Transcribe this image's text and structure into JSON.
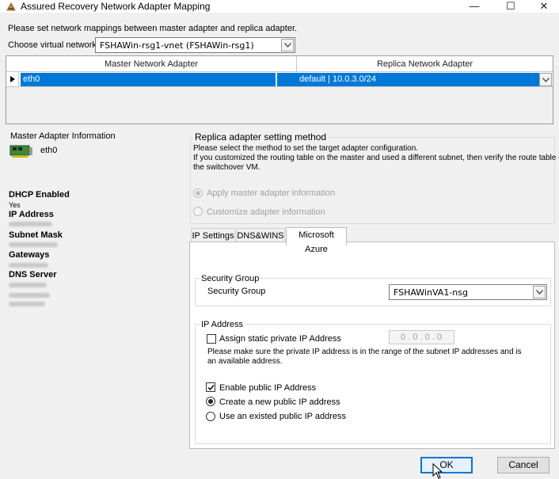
{
  "window": {
    "title": "Assured Recovery Network Adapter Mapping",
    "minimize": "—",
    "maximize": "☐",
    "close": "✕"
  },
  "instructions": "Please set network mappings between master adapter and replica adapter.",
  "virtual_network": {
    "label": "Choose virtual network",
    "value": "FSHAWin-rsg1-vnet (FSHAWin-rsg1)"
  },
  "mapping_grid": {
    "columns": [
      "Master Network Adapter",
      "Replica Network Adapter"
    ],
    "rows": [
      {
        "master": "eth0",
        "replica": "default | 10.0.3.0/24"
      }
    ]
  },
  "master_info": {
    "title": "Master Adapter Information",
    "adapter_name": "eth0",
    "dhcp_label": "DHCP Enabled",
    "dhcp_value": "Yes",
    "ip_label": "IP Address",
    "subnet_label": "Subnet Mask",
    "gateways_label": "Gateways",
    "dns_label": "DNS Server"
  },
  "replica_method": {
    "title": "Replica adapter setting method",
    "description_1": "Please select the method to set the target adapter configuration.",
    "description_2": "If you customized the routing table on the master and used a different subnet, then verify the route table of",
    "description_3": "the switchover VM.",
    "option_apply": "Apply master adapter information",
    "option_customize": "Customize adapter information"
  },
  "tabs": [
    "IP Settings",
    "DNS&WINS",
    "Microsoft Azure"
  ],
  "active_tab": "Microsoft Azure",
  "azure": {
    "security_group": {
      "group_title": "Security Group",
      "label": "Security Group",
      "value": "FSHAWinVA1-nsg"
    },
    "ip_address": {
      "group_title": "IP Address",
      "static_label": "Assign static private IP Address",
      "static_value": "0 .  0 .  0 .  0",
      "static_note_1": "Please make sure the private IP address is in the range of the subnet IP addresses and is",
      "static_note_2": "an available address.",
      "public_label": "Enable public IP Address",
      "create_new_label": "Create a new public IP address",
      "use_existing_label": "Use an existed public IP address"
    }
  },
  "buttons": {
    "ok": "OK",
    "cancel": "Cancel"
  },
  "icons": {
    "app": "network-adapter-icon",
    "adapter": "network-card-icon"
  }
}
